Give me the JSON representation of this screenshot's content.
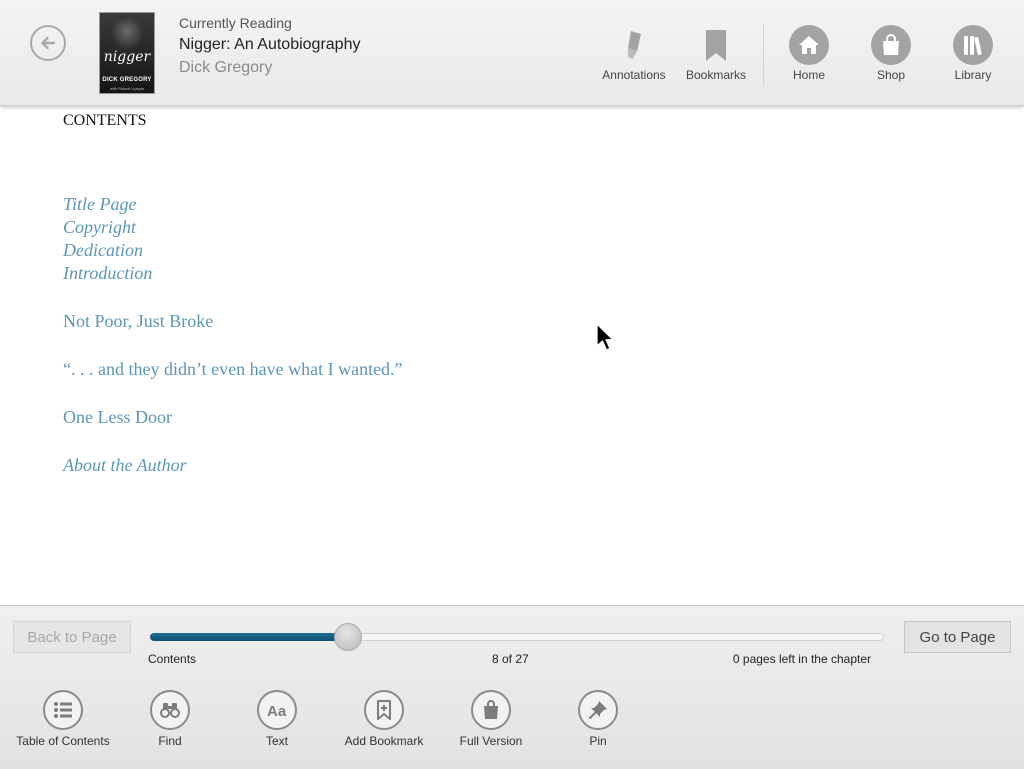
{
  "header": {
    "currently_reading_label": "Currently Reading",
    "book_title": "Nigger: An Autobiography",
    "book_author": "Dick Gregory",
    "cover": {
      "script_text": "nigger",
      "author_text": "DICK GREGORY",
      "sub_text": "with Robert Lipsyte"
    },
    "toolbar": {
      "annotations": "Annotations",
      "bookmarks": "Bookmarks",
      "home": "Home",
      "shop": "Shop",
      "library": "Library"
    }
  },
  "content": {
    "heading": "CONTENTS",
    "toc": [
      {
        "label": "Title Page",
        "italic": true
      },
      {
        "label": "Copyright",
        "italic": true
      },
      {
        "label": "Dedication",
        "italic": true
      },
      {
        "label": "Introduction",
        "italic": true
      },
      {
        "label": "Not Poor, Just Broke",
        "italic": false
      },
      {
        "label": "“. . . and they didn’t even have what I wanted.”",
        "italic": false
      },
      {
        "label": "One Less Door",
        "italic": false
      },
      {
        "label": "About the Author",
        "italic": true
      }
    ]
  },
  "footer": {
    "back_to_page": "Back to Page",
    "go_to_page": "Go to Page",
    "progress": {
      "location": "Contents",
      "page_indicator": "8 of 27",
      "current_page": 8,
      "total_pages": 27,
      "pages_left": "0 pages left in the chapter"
    },
    "actions": {
      "toc": "Table of Contents",
      "find": "Find",
      "text": "Text",
      "add_bookmark": "Add Bookmark",
      "full_version": "Full Version",
      "pin": "Pin"
    }
  },
  "colors": {
    "link": "#5b96b8",
    "progress_fill": "#1e6d94",
    "icon_gray": "#a3a3a3"
  },
  "icons": {
    "back": "back-arrow-icon",
    "annotations": "marker-icon",
    "bookmarks": "bookmark-icon",
    "home": "home-icon",
    "shop": "shopping-bag-icon",
    "library": "books-icon",
    "toc": "list-icon",
    "find": "binoculars-icon",
    "text": "font-size-icon",
    "add_bookmark": "bookmark-plus-icon",
    "full_version": "shopping-bag-icon",
    "pin": "pushpin-icon"
  }
}
